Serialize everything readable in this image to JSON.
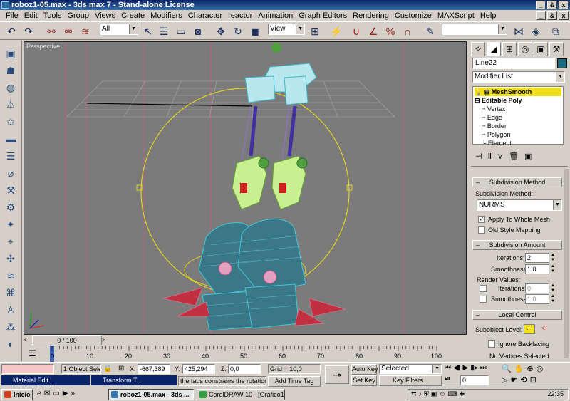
{
  "window": {
    "title": "roboz1-05.max - 3ds max 7 - Stand-alone License",
    "minimize": "_",
    "restore": "&",
    "close": "x"
  },
  "menu": [
    "File",
    "Edit",
    "Tools",
    "Group",
    "Views",
    "Create",
    "Modifiers",
    "Character",
    "reactor",
    "Animation",
    "Graph Editors",
    "Rendering",
    "Customize",
    "MAXScript",
    "Help"
  ],
  "mdi_buttons": [
    "_",
    "&",
    "x"
  ],
  "toolbar": {
    "selection_filter": "All",
    "ref_coord": "View",
    "named_selection": ""
  },
  "viewport": {
    "label": "Perspective"
  },
  "command_panel": {
    "object_name": "Line22",
    "object_color": "#1a6a7a",
    "modifier_list": "Modifier List",
    "stack": [
      {
        "label": "MeshSmooth",
        "selected": true
      },
      {
        "label": "Editable Poly",
        "selected": false
      },
      {
        "label": "Vertex"
      },
      {
        "label": "Edge"
      },
      {
        "label": "Border"
      },
      {
        "label": "Polygon"
      },
      {
        "label": "Element"
      }
    ],
    "subdivision_method": {
      "header": "Subdivision Method",
      "label": "Subdivision Method:",
      "value": "NURMS",
      "apply_whole_mesh": "Apply To Whole Mesh",
      "apply_whole_mesh_checked": true,
      "old_style": "Old Style Mapping",
      "old_style_checked": false
    },
    "subdivision_amount": {
      "header": "Subdivision Amount",
      "iterations_label": "Iterations:",
      "iterations": "2",
      "smoothness_label": "Smoothness:",
      "smoothness": "1,0",
      "render_values": "Render Values:",
      "r_iterations_label": "Iterations:",
      "r_iterations": "0",
      "r_smoothness_label": "Smoothness:",
      "r_smoothness": "1,0"
    },
    "local_control": {
      "header": "Local Control",
      "subobject_level": "Subobject Level:",
      "ignore_backfacing": "Ignore Backfacing",
      "no_vertices": "No Vertices Selected"
    }
  },
  "timeslider": {
    "label": "0 / 100"
  },
  "trackbar": {
    "ticks": [
      "0",
      "10",
      "20",
      "30",
      "40",
      "50",
      "60",
      "70",
      "80",
      "90",
      "100"
    ]
  },
  "status": {
    "selection": "1 Object Sele",
    "x_label": "X:",
    "x": "-667,389",
    "y_label": "Y:",
    "y": "425,294",
    "z_label": "Z:",
    "z": "0,0",
    "grid": "Grid = 10,0",
    "prompt": "the tabs constrains the rotation",
    "add_time_tag": "Add Time Tag",
    "auto_key": "Auto Key",
    "set_key": "Set Key",
    "key_mode": "Selected",
    "key_filters": "Key Filters...",
    "frame": "0",
    "mini1": "Material Edit...",
    "mini2": "Transform T..."
  },
  "taskbar": {
    "start": "Inicio",
    "items": [
      "roboz1-05.max - 3ds ...",
      "CorelDRAW 10 - [Gráfico1]"
    ],
    "clock": "22:35"
  }
}
